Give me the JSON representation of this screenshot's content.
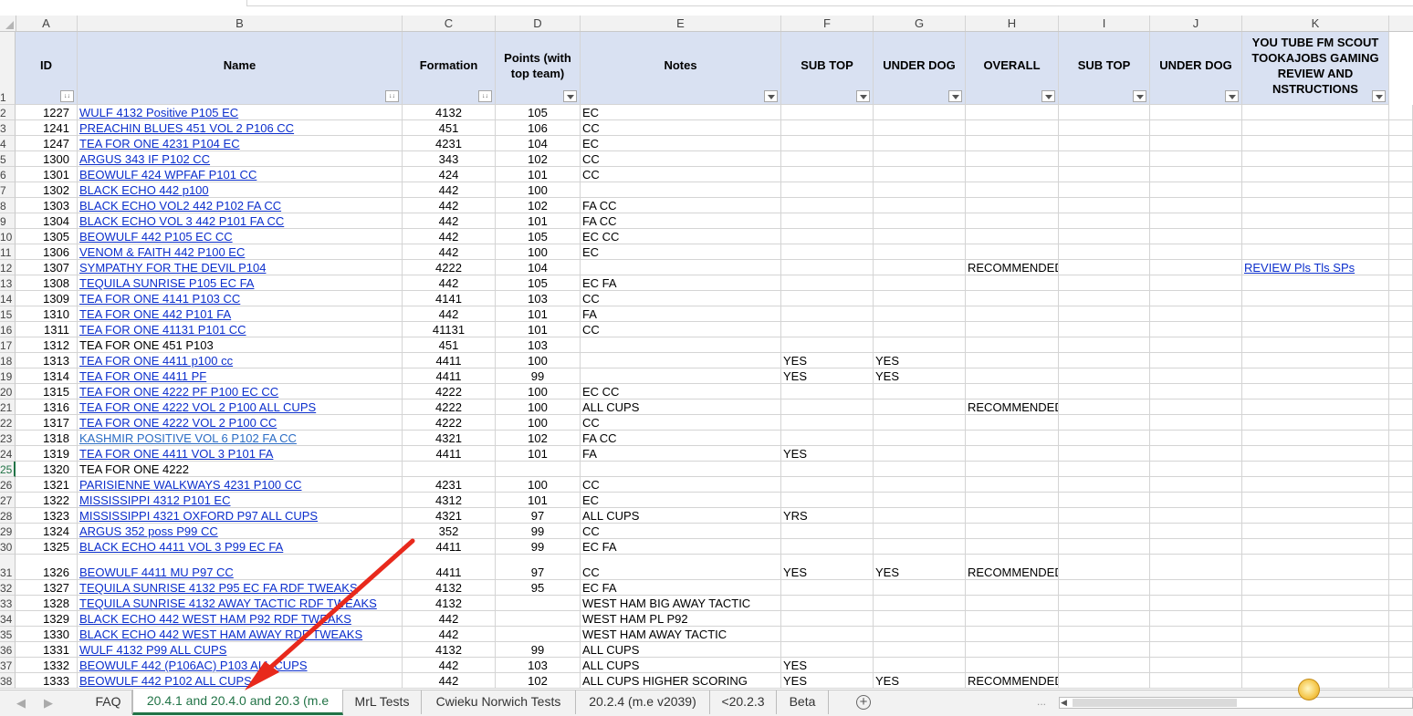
{
  "columns": [
    "A",
    "B",
    "C",
    "D",
    "E",
    "F",
    "G",
    "H",
    "I",
    "J",
    "K"
  ],
  "headers": [
    {
      "col": "A",
      "lines": [
        "ID"
      ],
      "filter": "sort"
    },
    {
      "col": "B",
      "lines": [
        "Name"
      ],
      "filter": "sort"
    },
    {
      "col": "C",
      "lines": [
        "Formation"
      ],
      "filter": "sort"
    },
    {
      "col": "D",
      "lines": [
        "Points (with",
        "top team)"
      ],
      "filter": "dropdown"
    },
    {
      "col": "E",
      "lines": [
        "Notes"
      ],
      "filter": "dropdown"
    },
    {
      "col": "F",
      "lines": [
        "SUB TOP"
      ],
      "filter": "dropdown"
    },
    {
      "col": "G",
      "lines": [
        "UNDER DOG"
      ],
      "filter": "dropdown"
    },
    {
      "col": "H",
      "lines": [
        "OVERALL"
      ],
      "filter": "dropdown"
    },
    {
      "col": "I",
      "lines": [
        "SUB TOP"
      ],
      "filter": "dropdown"
    },
    {
      "col": "J",
      "lines": [
        "UNDER DOG"
      ],
      "filter": "dropdown"
    },
    {
      "col": "K",
      "lines": [
        "YOU TUBE   FM SCOUT",
        "TOOKAJOBS GAMING",
        "REVIEW AND",
        "NSTRUCTIONS"
      ],
      "filter": "dropdown"
    }
  ],
  "rows": [
    {
      "n": "2",
      "id": "1227",
      "name": "WULF 4132 Positive P105 EC",
      "link": true,
      "formation": "4132",
      "points": "105",
      "notes": "EC",
      "f": "",
      "g": "",
      "h": "",
      "k": ""
    },
    {
      "n": "3",
      "id": "1241",
      "name": "PREACHIN BLUES 451 VOL 2 P106 CC",
      "link": true,
      "formation": "451",
      "points": "106",
      "notes": "CC",
      "f": "",
      "g": "",
      "h": "",
      "k": ""
    },
    {
      "n": "4",
      "id": "1247",
      "name": "TEA FOR ONE 4231 P104 EC",
      "link": true,
      "formation": "4231",
      "points": "104",
      "notes": "EC",
      "f": "",
      "g": "",
      "h": "",
      "k": ""
    },
    {
      "n": "5",
      "id": "1300",
      "name": "ARGUS 343 IF P102 CC",
      "link": true,
      "formation": "343",
      "points": "102",
      "notes": "CC",
      "f": "",
      "g": "",
      "h": "",
      "k": ""
    },
    {
      "n": "6",
      "id": "1301",
      "name": "BEOWULF 424 WPFAF P101 CC",
      "link": true,
      "formation": "424",
      "points": "101",
      "notes": "CC",
      "f": "",
      "g": "",
      "h": "",
      "k": ""
    },
    {
      "n": "7",
      "id": "1302",
      "name": "BLACK ECHO 442 p100",
      "link": true,
      "formation": "442",
      "points": "100",
      "notes": "",
      "f": "",
      "g": "",
      "h": "",
      "k": ""
    },
    {
      "n": "8",
      "id": "1303",
      "name": "BLACK ECHO VOL2 442 P102 FA CC",
      "link": true,
      "formation": "442",
      "points": "102",
      "notes": "FA CC",
      "f": "",
      "g": "",
      "h": "",
      "k": ""
    },
    {
      "n": "9",
      "id": "1304",
      "name": "BLACK ECHO VOL 3 442 P101 FA CC",
      "link": true,
      "formation": "442",
      "points": "101",
      "notes": "FA CC",
      "f": "",
      "g": "",
      "h": "",
      "k": ""
    },
    {
      "n": "10",
      "id": "1305",
      "name": "BEOWULF 442 P105 EC CC",
      "link": true,
      "formation": "442",
      "points": "105",
      "notes": "EC CC",
      "f": "",
      "g": "",
      "h": "",
      "k": ""
    },
    {
      "n": "11",
      "id": "1306",
      "name": "VENOM & FAITH 442 P100 EC",
      "link": true,
      "formation": "442",
      "points": "100",
      "notes": "EC",
      "f": "",
      "g": "",
      "h": "",
      "k": ""
    },
    {
      "n": "12",
      "id": "1307",
      "name": "SYMPATHY FOR THE DEVIL P104",
      "link": true,
      "formation": "4222",
      "points": "104",
      "notes": "",
      "f": "",
      "g": "",
      "h": "RECOMMENDED",
      "k": "REVIEW Pls Tls SPs"
    },
    {
      "n": "13",
      "id": "1308",
      "name": "TEQUILA SUNRISE P105 EC FA",
      "link": true,
      "formation": "442",
      "points": "105",
      "notes": "EC FA",
      "f": "",
      "g": "",
      "h": "",
      "k": ""
    },
    {
      "n": "14",
      "id": "1309",
      "name": "TEA FOR ONE 4141 P103 CC",
      "link": true,
      "formation": "4141",
      "points": "103",
      "notes": "CC",
      "f": "",
      "g": "",
      "h": "",
      "k": ""
    },
    {
      "n": "15",
      "id": "1310",
      "name": "TEA FOR ONE 442 P101 FA",
      "link": true,
      "formation": "442",
      "points": "101",
      "notes": "FA",
      "f": "",
      "g": "",
      "h": "",
      "k": ""
    },
    {
      "n": "16",
      "id": "1311",
      "name": "TEA FOR ONE 41131 P101 CC",
      "link": true,
      "formation": "41131",
      "points": "101",
      "notes": "CC",
      "f": "",
      "g": "",
      "h": "",
      "k": ""
    },
    {
      "n": "17",
      "id": "1312",
      "name": "TEA FOR ONE 451 P103",
      "link": false,
      "formation": "451",
      "points": "103",
      "notes": "",
      "f": "",
      "g": "",
      "h": "",
      "k": ""
    },
    {
      "n": "18",
      "id": "1313",
      "name": "TEA FOR ONE 4411 p100 cc",
      "link": true,
      "formation": "4411",
      "points": "100",
      "notes": "",
      "f": "YES",
      "g": "YES",
      "h": "",
      "k": ""
    },
    {
      "n": "19",
      "id": "1314",
      "name": "TEA FOR ONE 4411 PF",
      "link": true,
      "formation": "4411",
      "points": "99",
      "notes": "",
      "f": "YES",
      "g": "YES",
      "h": "",
      "k": ""
    },
    {
      "n": "20",
      "id": "1315",
      "name": "TEA FOR ONE 4222 PF P100 EC CC",
      "link": true,
      "formation": "4222",
      "points": "100",
      "notes": "EC CC",
      "f": "",
      "g": "",
      "h": "",
      "k": ""
    },
    {
      "n": "21",
      "id": "1316",
      "name": "TEA FOR ONE 4222 VOL 2 P100 ALL CUPS",
      "link": true,
      "formation": "4222",
      "points": "100",
      "notes": "ALL CUPS",
      "f": "",
      "g": "",
      "h": "RECOMMENDED",
      "k": ""
    },
    {
      "n": "22",
      "id": "1317",
      "name": "TEA FOR ONE 4222 VOL 2 P100 CC",
      "link": true,
      "formation": "4222",
      "points": "100",
      "notes": "CC",
      "f": "",
      "g": "",
      "h": "",
      "k": ""
    },
    {
      "n": "23",
      "id": "1318",
      "name": "KASHMIR POSITIVE VOL 6 P102 FA CC",
      "link": true,
      "linkstyle": "lb",
      "formation": "4321",
      "points": "102",
      "notes": "FA CC",
      "f": "",
      "g": "",
      "h": "",
      "k": ""
    },
    {
      "n": "24",
      "id": "1319",
      "name": "TEA FOR ONE 4411 VOL 3 P101 FA",
      "link": true,
      "formation": "4411",
      "points": "101",
      "notes": "FA",
      "f": "YES",
      "g": "",
      "h": "",
      "k": ""
    },
    {
      "n": "25",
      "id": "1320",
      "name": "TEA FOR ONE 4222",
      "link": false,
      "formation": "",
      "points": "",
      "notes": "",
      "f": "",
      "g": "",
      "h": "",
      "k": "",
      "sel": true
    },
    {
      "n": "26",
      "id": "1321",
      "name": "PARISIENNE WALKWAYS 4231 P100 CC",
      "link": true,
      "formation": "4231",
      "points": "100",
      "notes": "CC",
      "f": "",
      "g": "",
      "h": "",
      "k": ""
    },
    {
      "n": "27",
      "id": "1322",
      "name": "MISSISSIPPI 4312 P101 EC",
      "link": true,
      "formation": "4312",
      "points": "101",
      "notes": "EC",
      "f": "",
      "g": "",
      "h": "",
      "k": ""
    },
    {
      "n": "28",
      "id": "1323",
      "name": "MISSISSIPPI 4321 OXFORD P97 ALL CUPS",
      "link": true,
      "formation": "4321",
      "points": "97",
      "notes": "ALL CUPS",
      "f": "YRS",
      "g": "",
      "h": "",
      "k": ""
    },
    {
      "n": "29",
      "id": "1324",
      "name": "ARGUS 352 poss P99 CC",
      "link": true,
      "formation": "352",
      "points": "99",
      "notes": "CC",
      "f": "",
      "g": "",
      "h": "",
      "k": ""
    },
    {
      "n": "30",
      "id": "1325",
      "name": "BLACK ECHO 4411 VOL 3  P99 EC FA",
      "link": true,
      "formation": "4411",
      "points": "99",
      "notes": "EC FA",
      "f": "",
      "g": "",
      "h": "",
      "k": ""
    },
    {
      "n": "31",
      "id": "1326",
      "name": "BEOWULF 4411 MU P97 CC",
      "link": true,
      "formation": "4411",
      "points": "97",
      "notes": "CC",
      "f": "YES",
      "g": "YES",
      "h": "RECOMMENDED",
      "k": "",
      "tall": true
    },
    {
      "n": "32",
      "id": "1327",
      "name": "TEQUILA SUNRISE 4132 P95 EC FA  RDF TWEAKS",
      "link": true,
      "formation": "4132",
      "points": "95",
      "notes": "EC FA",
      "f": "",
      "g": "",
      "h": "",
      "k": ""
    },
    {
      "n": "33",
      "id": "1328",
      "name": "TEQUILA SUNRISE 4132 AWAY TACTIC RDF TWEAKS",
      "link": true,
      "formation": "4132",
      "points": "",
      "notes": "WEST HAM BIG AWAY TACTIC",
      "f": "",
      "g": "",
      "h": "",
      "k": ""
    },
    {
      "n": "34",
      "id": "1329",
      "name": "BLACK ECHO 442 WEST HAM P92 RDF TWEAKS",
      "link": true,
      "formation": "442",
      "points": "",
      "notes": "WEST HAM PL P92",
      "f": "",
      "g": "",
      "h": "",
      "k": ""
    },
    {
      "n": "35",
      "id": "1330",
      "name": "BLACK ECHO 442 WEST HAM AWAY RDF TWEAKS",
      "link": true,
      "formation": "442",
      "points": "",
      "notes": "WEST HAM AWAY TACTIC",
      "f": "",
      "g": "",
      "h": "",
      "k": ""
    },
    {
      "n": "36",
      "id": "1331",
      "name": "WULF 4132 P99 ALL CUPS",
      "link": true,
      "formation": "4132",
      "points": "99",
      "notes": "ALL CUPS",
      "f": "",
      "g": "",
      "h": "",
      "k": ""
    },
    {
      "n": "37",
      "id": "1332",
      "name": "BEOWULF 442 (P106AC) P103 ALL CUPS",
      "link": true,
      "formation": "442",
      "points": "103",
      "notes": "ALL CUPS",
      "f": "YES",
      "g": "",
      "h": "",
      "k": ""
    },
    {
      "n": "38",
      "id": "1333",
      "name": "BEOWULF 442 P102 ALL CUPS",
      "link": true,
      "formation": "442",
      "points": "102",
      "notes": "ALL CUPS HIGHER SCORING",
      "f": "YES",
      "g": "YES",
      "h": "RECOMMENDED",
      "k": ""
    }
  ],
  "tabs": [
    {
      "label": "FAQ",
      "active": false
    },
    {
      "label": "20.4.1 and 20.4.0 and 20.3 (m.e",
      "active": true
    },
    {
      "label": "MrL Tests",
      "active": false
    },
    {
      "label": "Cwieku Norwich Tests",
      "active": false
    },
    {
      "label": "20.2.4 (m.e v2039)",
      "active": false
    },
    {
      "label": "<20.2.3",
      "active": false
    },
    {
      "label": "Beta",
      "active": false
    }
  ],
  "tabbar": {
    "add_sheet": "+",
    "more": "...",
    "nav_prev": "◀",
    "nav_next": "▶"
  },
  "colors": {
    "header_fill": "#d9e1f2",
    "link": "#0b2ecc",
    "active_tab": "#217346",
    "arrow": "#e8291c"
  },
  "icons": {
    "add_sheet": "plus-circle-icon",
    "filter": "filter-dropdown-icon",
    "annotation": "red-arrow"
  }
}
